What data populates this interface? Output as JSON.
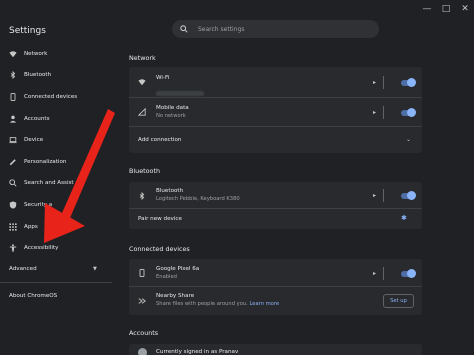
{
  "window": {
    "title": "Settings",
    "controls": {
      "minimize": "—",
      "maximize": "□",
      "close": "✕"
    }
  },
  "search": {
    "placeholder": "Search settings"
  },
  "sidebar": {
    "items": [
      {
        "label": "Network",
        "icon": "wifi-icon"
      },
      {
        "label": "Bluetooth",
        "icon": "bluetooth-icon"
      },
      {
        "label": "Connected devices",
        "icon": "phone-icon"
      },
      {
        "label": "Accounts",
        "icon": "person-icon"
      },
      {
        "label": "Device",
        "icon": "laptop-icon"
      },
      {
        "label": "Personalization",
        "icon": "pencil-icon"
      },
      {
        "label": "Search and Assist",
        "icon": "search-icon"
      },
      {
        "label": "Security a",
        "icon": "shield-icon"
      },
      {
        "label": "Apps",
        "icon": "apps-grid-icon"
      },
      {
        "label": "Accessibility",
        "icon": "accessibility-icon"
      }
    ],
    "advanced": "Advanced",
    "about": "About ChromeOS"
  },
  "network": {
    "heading": "Network",
    "wifi": {
      "label": "Wi-Fi",
      "enabled": true
    },
    "mobile": {
      "label": "Mobile data",
      "status": "No network",
      "enabled": true
    },
    "add": "Add connection"
  },
  "bluetooth": {
    "heading": "Bluetooth",
    "main": {
      "label": "Bluetooth",
      "devices": "Logitech Pebble, Keyboard K380",
      "enabled": true
    },
    "pair": "Pair new device"
  },
  "connected": {
    "heading": "Connected devices",
    "phone": {
      "label": "Google Pixel 6a",
      "status": "Enabled",
      "enabled": true
    },
    "nearby": {
      "label": "Nearby Share",
      "desc": "Share files with people around you.",
      "link": "Learn more",
      "button": "Set up"
    }
  },
  "accounts": {
    "heading": "Accounts",
    "row": "Currently signed in as Pranav"
  },
  "colors": {
    "accent": "#8ab4f8",
    "arrow": "#e8231a",
    "background": "#202124",
    "card": "#292a2d"
  }
}
